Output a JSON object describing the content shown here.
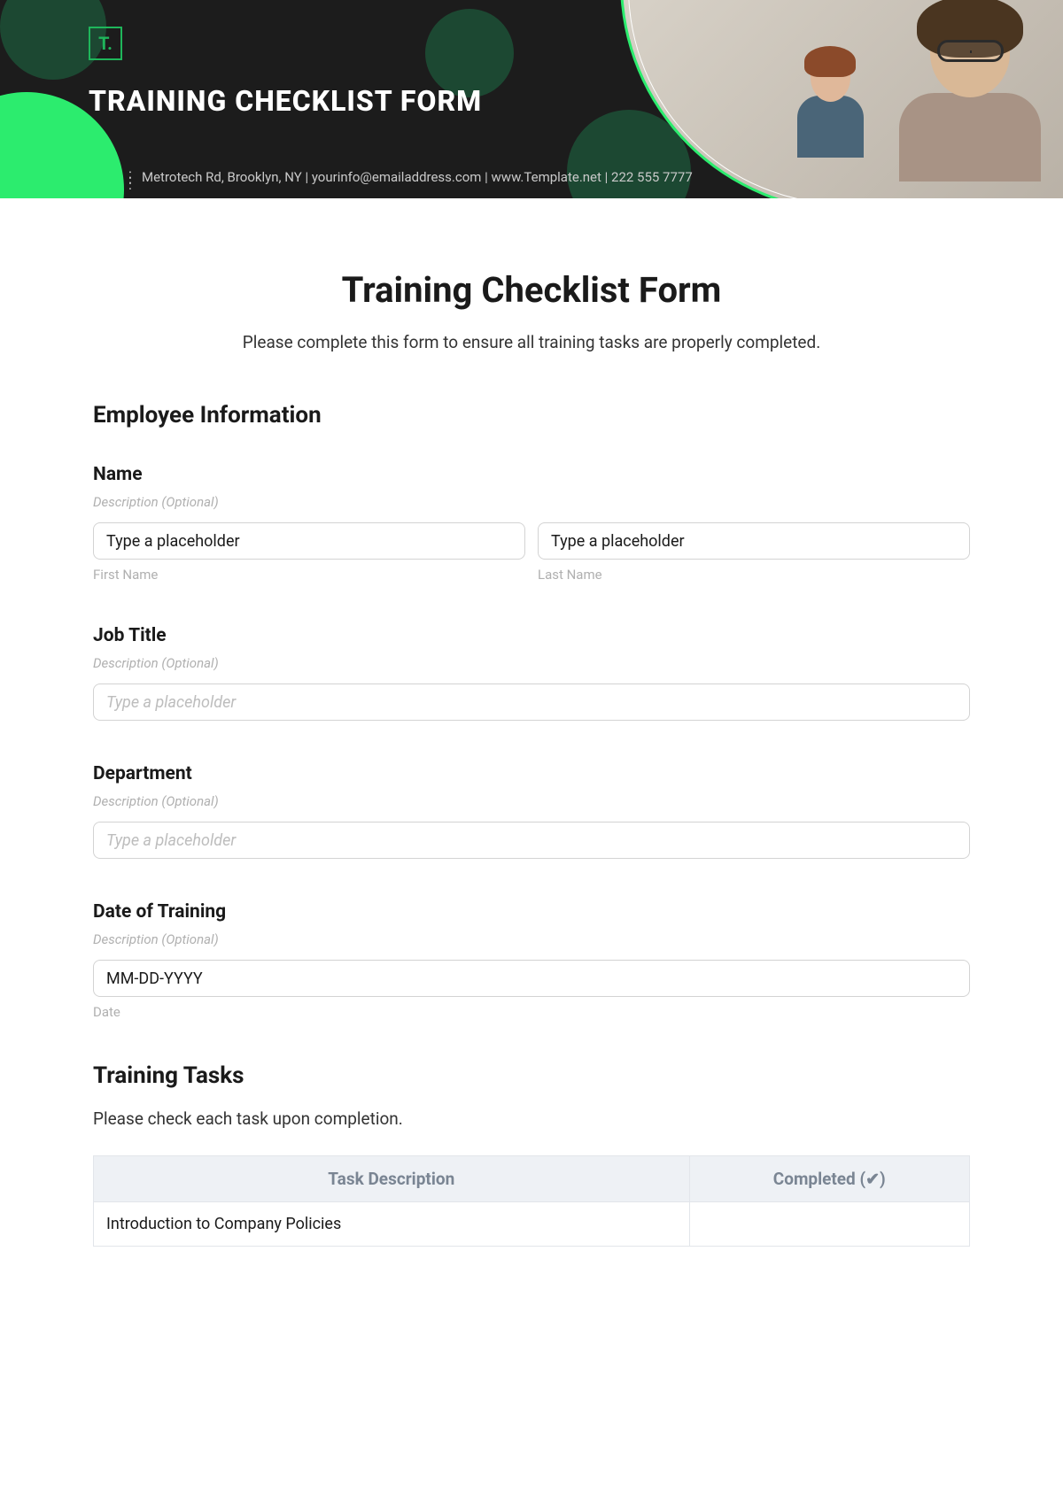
{
  "banner": {
    "logo_text": "T.",
    "title": "TRAINING CHECKLIST FORM",
    "contact_line": "Metrotech Rd, Brooklyn, NY  |  yourinfo@emailaddress.com  |  www.Template.net  |  222 555 7777"
  },
  "page": {
    "title": "Training Checklist Form",
    "subtitle": "Please complete this form to ensure all training tasks are properly completed."
  },
  "sections": {
    "employee_info": "Employee Information",
    "training_tasks": "Training Tasks"
  },
  "fields": {
    "name": {
      "label": "Name",
      "desc": "Description (Optional)",
      "first_placeholder": "Type a placeholder",
      "first_value": "Type a placeholder",
      "first_sub": "First Name",
      "last_placeholder": "Type a placeholder",
      "last_value": "Type a placeholder",
      "last_sub": "Last Name"
    },
    "job_title": {
      "label": "Job Title",
      "desc": "Description (Optional)",
      "placeholder": "Type a placeholder"
    },
    "department": {
      "label": "Department",
      "desc": "Description (Optional)",
      "placeholder": "Type a placeholder"
    },
    "date_of_training": {
      "label": "Date of Training",
      "desc": "Description (Optional)",
      "value": "MM-DD-YYYY",
      "sub": "Date"
    }
  },
  "tasks": {
    "intro": "Please check each task upon completion.",
    "headers": {
      "desc": "Task Description",
      "completed": "Completed (✔)"
    },
    "rows": [
      {
        "desc": "Introduction to Company Policies"
      }
    ]
  }
}
